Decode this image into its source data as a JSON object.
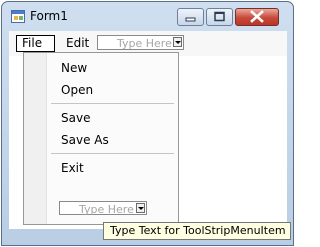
{
  "window": {
    "title": "Form1"
  },
  "menubar": {
    "items": [
      {
        "label": "File"
      },
      {
        "label": "Edit"
      }
    ],
    "type_here": "Type Here"
  },
  "file_menu": {
    "items": [
      "New",
      "Open",
      "Save",
      "Save As",
      "Exit"
    ],
    "type_here": "Type Here"
  },
  "tooltip": {
    "text": "Type Text for ToolStripMenuItem"
  },
  "colors": {
    "close_button": "#c7483a",
    "tooltip_bg": "#ffffe1",
    "titlebar": "#c4d6eb"
  },
  "icons": [
    "form-app-icon",
    "minimize-icon",
    "maximize-icon",
    "close-icon",
    "dropdown-arrow-icon"
  ]
}
